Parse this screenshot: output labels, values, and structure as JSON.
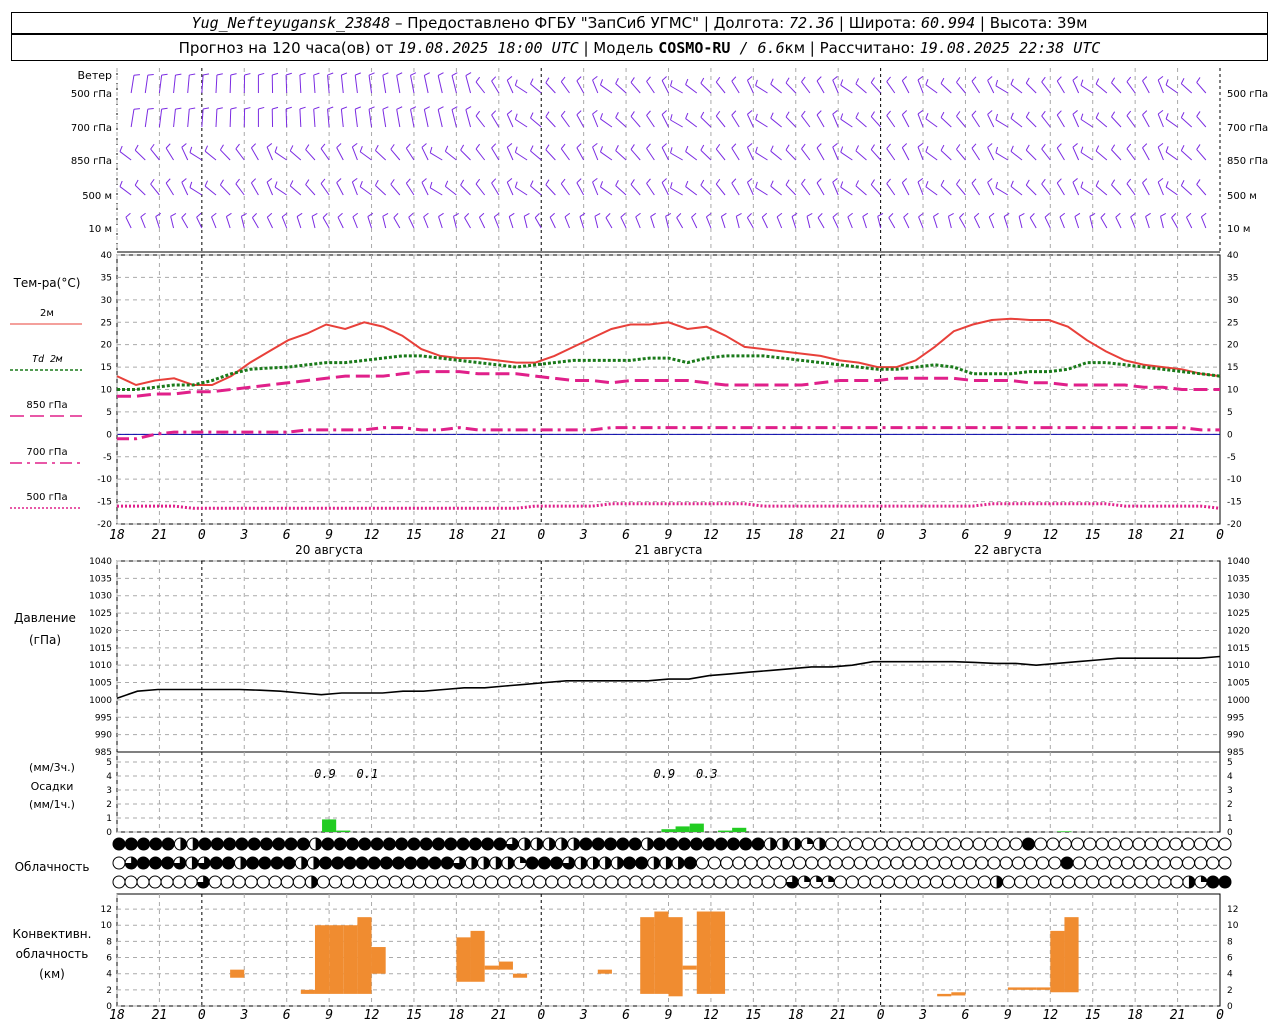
{
  "header": {
    "station": "Yug_Nefteyugansk_23848",
    "provider": " – Предоставлено ФГБУ \"ЗапСиб УГМС\" | ",
    "lon_label": "Долгота: ",
    "lon_value": "72.36",
    "lat_label": " | Широта: ",
    "lat_value": "60.994",
    "alt_label": " | Высота: 39м",
    "forecast_prefix": "Прогноз на 120 часа(ов)  от ",
    "forecast_time": "19.08.2025 18:00 UTC",
    "model_label": "  | Модель ",
    "model_name": "COSMO-RU",
    "model_res": " / 6.6",
    "model_res_unit": "км | Рассчитано: ",
    "computed_time": "19.08.2025 22:38 UTC"
  },
  "wind_panel": {
    "title": "Ветер",
    "levels": [
      "500 гПа",
      "700 гПа",
      "850 гПа",
      "500 м",
      "10 м"
    ],
    "color": "#7b2be2"
  },
  "x_axis": {
    "hour_labels": [
      "18",
      "21",
      "0",
      "3",
      "6",
      "9",
      "12",
      "15",
      "18",
      "21",
      "0",
      "3",
      "6",
      "9",
      "12",
      "15",
      "18",
      "21",
      "0",
      "3",
      "6",
      "9",
      "12",
      "15",
      "18",
      "21",
      "0"
    ],
    "day_labels": [
      "20 августа",
      "21 августа",
      "22 августа"
    ]
  },
  "chart_data": [
    {
      "type": "line",
      "panel": "temperature",
      "title": "Тем-ра(°C)",
      "x_hours": [
        0,
        3,
        6,
        9,
        12,
        15,
        18,
        21,
        24,
        27,
        30,
        33,
        36,
        39,
        42,
        45,
        48,
        51,
        54,
        57,
        60,
        63,
        66,
        69,
        72,
        75,
        78,
        81,
        84,
        87,
        90,
        93,
        96,
        99,
        102,
        105,
        108,
        111,
        114,
        117,
        120,
        123,
        126,
        129,
        132,
        135,
        138,
        141,
        144,
        147,
        150,
        153,
        156,
        159,
        162,
        165,
        168,
        171,
        174,
        177,
        180,
        183,
        186,
        189,
        192,
        195,
        198,
        201,
        204,
        207,
        210,
        213,
        216,
        219,
        222,
        225,
        228,
        231,
        234
      ],
      "ylim": [
        -20,
        40
      ],
      "yticks": [
        -20,
        -15,
        -10,
        -5,
        0,
        5,
        10,
        15,
        20,
        25,
        30,
        35,
        40
      ],
      "series": [
        {
          "name": "2м",
          "color": "#e8403a",
          "dash": "solid",
          "values": [
            13,
            11,
            12,
            12.5,
            11,
            11,
            13,
            16,
            18.5,
            21,
            22.5,
            24.5,
            23.5,
            25,
            24,
            22,
            19,
            17.5,
            17,
            17,
            16.5,
            16,
            16,
            17.5,
            19.5,
            21.5,
            23.5,
            24.5,
            24.5,
            25,
            23.5,
            24,
            22,
            19.5,
            19,
            18.5,
            18,
            17.5,
            16.5,
            16,
            15,
            15,
            16.5,
            19.5,
            23,
            24.5,
            25.5,
            25.8,
            25.5,
            25.5,
            24,
            21,
            18.5,
            16.5,
            15.5,
            15,
            14.5,
            13.5,
            13
          ]
        },
        {
          "name": "Td 2м",
          "color": "#1a7a1a",
          "dash": "dot",
          "values": [
            10,
            10,
            10.5,
            11,
            11,
            12,
            13.5,
            14.5,
            14.8,
            15,
            15.5,
            16,
            16,
            16.5,
            17,
            17.5,
            17.5,
            17,
            16.5,
            16,
            15.5,
            15,
            15.5,
            16,
            16.5,
            16.5,
            16.5,
            16.5,
            17,
            17,
            16,
            17,
            17.5,
            17.5,
            17.5,
            17,
            16.5,
            16,
            15.5,
            15,
            14.5,
            14.5,
            15,
            15.5,
            15,
            13.5,
            13.5,
            13.5,
            14,
            14,
            14.5,
            16,
            16,
            15.5,
            15,
            14.5,
            14,
            13.5,
            13
          ]
        },
        {
          "name": "850 гПа",
          "color": "#e0208a",
          "dash": "dash",
          "values": [
            8.5,
            8.5,
            9,
            9,
            9.5,
            9.5,
            10,
            10.5,
            11,
            11.5,
            12,
            12.5,
            13,
            13,
            13,
            13.5,
            14,
            14,
            14,
            13.5,
            13.5,
            13.5,
            13,
            12.5,
            12,
            12,
            11.5,
            12,
            12,
            12,
            12,
            11.5,
            11,
            11,
            11,
            11,
            11,
            11.5,
            12,
            12,
            12,
            12.5,
            12.5,
            12.5,
            12.5,
            12,
            12,
            12,
            11.5,
            11.5,
            11,
            11,
            11,
            11,
            10.5,
            10.5,
            10,
            10,
            10
          ]
        },
        {
          "name": "700 гПа",
          "color": "#e0208a",
          "dash": "dashdot",
          "values": [
            -1,
            -1,
            0,
            0.5,
            0.5,
            0.5,
            0.5,
            0.5,
            0.5,
            0.5,
            1,
            1,
            1,
            1,
            1.5,
            1.5,
            1,
            1,
            1.5,
            1,
            1,
            1,
            1,
            1,
            1,
            1,
            1.5,
            1.5,
            1.5,
            1.5,
            1.5,
            1.5,
            1.5,
            1.5,
            1.5,
            1.5,
            1.5,
            1.5,
            1.5,
            1.5,
            1.5,
            1.5,
            1.5,
            1.5,
            1.5,
            1.5,
            1.5,
            1.5,
            1.5,
            1.5,
            1.5,
            1.5,
            1.5,
            1.5,
            1.5,
            1.5,
            1.5,
            1,
            1
          ]
        },
        {
          "name": "500 гПа",
          "color": "#e0208a",
          "dash": "dotfine",
          "values": [
            -16,
            -16,
            -16,
            -16,
            -16.5,
            -16.5,
            -16.5,
            -16.5,
            -16.5,
            -16.5,
            -16.5,
            -16.5,
            -16.5,
            -16.5,
            -16.5,
            -16.5,
            -16.5,
            -16.5,
            -16.5,
            -16.5,
            -16.5,
            -16.5,
            -16,
            -16,
            -16,
            -16,
            -15.5,
            -15.5,
            -15.5,
            -15.5,
            -15.5,
            -15.5,
            -15.5,
            -15.5,
            -16,
            -16,
            -16,
            -16,
            -16,
            -16,
            -16,
            -16,
            -16,
            -16,
            -16,
            -16,
            -15.5,
            -15.5,
            -15.5,
            -15.5,
            -15.5,
            -15.5,
            -15.5,
            -16,
            -16,
            -16,
            -16,
            -16,
            -16.5
          ]
        }
      ]
    },
    {
      "type": "line",
      "panel": "pressure",
      "title": "Давление",
      "unit": "(гПа)",
      "ylim": [
        985,
        1040
      ],
      "yticks": [
        985,
        990,
        995,
        1000,
        1005,
        1010,
        1015,
        1020,
        1025,
        1030,
        1035,
        1040
      ],
      "series": [
        {
          "name": "Давление",
          "color": "#000000",
          "dash": "solid",
          "values": [
            1000.5,
            1002.5,
            1003,
            1003,
            1003,
            1003,
            1003,
            1002.8,
            1002.5,
            1002,
            1001.5,
            1002,
            1002,
            1002,
            1002.5,
            1002.5,
            1003,
            1003.5,
            1003.5,
            1004,
            1004.5,
            1005,
            1005.5,
            1005.5,
            1005.5,
            1005.5,
            1005.5,
            1006,
            1006,
            1007,
            1007.5,
            1008,
            1008.5,
            1009,
            1009.5,
            1009.5,
            1010,
            1011,
            1011,
            1011,
            1011,
            1011,
            1010.8,
            1010.5,
            1010.5,
            1010,
            1010.5,
            1011,
            1011.5,
            1012,
            1012,
            1012,
            1012,
            1012,
            1012.5
          ]
        }
      ]
    },
    {
      "type": "bar",
      "panel": "precipitation",
      "title": "Осадки",
      "unit_top": "(мм/3ч.)",
      "unit_bottom": "(мм/1ч.)",
      "ylim": [
        0,
        5
      ],
      "yticks": [
        0,
        1,
        2,
        3,
        4,
        5
      ],
      "color": "#22cc22",
      "bars": [
        {
          "hour": 15,
          "value": 0.9
        },
        {
          "hour": 16,
          "value": 0.1
        },
        {
          "hour": 39,
          "value": 0.2
        },
        {
          "hour": 40,
          "value": 0.4
        },
        {
          "hour": 41,
          "value": 0.6
        },
        {
          "hour": 43,
          "value": 0.1
        },
        {
          "hour": 44,
          "value": 0.3
        },
        {
          "hour": 67,
          "value": 0.05
        }
      ],
      "totals_3h": [
        {
          "hour": 14,
          "label": "0.9"
        },
        {
          "hour": 17,
          "label": "0.1"
        },
        {
          "hour": 38,
          "label": "0.9"
        },
        {
          "hour": 41,
          "label": "0.3"
        }
      ]
    },
    {
      "type": "bar",
      "panel": "convective",
      "title_lines": [
        "Конвективн.",
        "облачность",
        "(км)"
      ],
      "ylim": [
        0,
        13
      ],
      "yticks": [
        0,
        2,
        4,
        6,
        8,
        10,
        12
      ],
      "color": "#f08c30",
      "bars": [
        {
          "hour": 8.5,
          "bottom": 3.5,
          "top": 4.5
        },
        {
          "hour": 13.5,
          "bottom": 1.5,
          "top": 2
        },
        {
          "hour": 14.5,
          "bottom": 1.5,
          "top": 10
        },
        {
          "hour": 15.5,
          "bottom": 1.5,
          "top": 10
        },
        {
          "hour": 16.5,
          "bottom": 1.5,
          "top": 10
        },
        {
          "hour": 17.5,
          "bottom": 1.5,
          "top": 11
        },
        {
          "hour": 18.5,
          "bottom": 4,
          "top": 7.3
        },
        {
          "hour": 24.5,
          "bottom": 3,
          "top": 8.5
        },
        {
          "hour": 25.5,
          "bottom": 3,
          "top": 9.3
        },
        {
          "hour": 26.5,
          "bottom": 4.5,
          "top": 5
        },
        {
          "hour": 27.5,
          "bottom": 4.5,
          "top": 5.5
        },
        {
          "hour": 28.5,
          "bottom": 3.5,
          "top": 4
        },
        {
          "hour": 34.5,
          "bottom": 4,
          "top": 4.5
        },
        {
          "hour": 37.5,
          "bottom": 1.5,
          "top": 11
        },
        {
          "hour": 38.5,
          "bottom": 1.5,
          "top": 11.7
        },
        {
          "hour": 39.5,
          "bottom": 1.2,
          "top": 11
        },
        {
          "hour": 40.5,
          "bottom": 4.5,
          "top": 5
        },
        {
          "hour": 41.5,
          "bottom": 1.5,
          "top": 11.7
        },
        {
          "hour": 42.5,
          "bottom": 1.5,
          "top": 11.7
        },
        {
          "hour": 58.5,
          "bottom": 1.2,
          "top": 1.5
        },
        {
          "hour": 59.5,
          "bottom": 1.3,
          "top": 1.7
        },
        {
          "hour": 63.5,
          "bottom": 2,
          "top": 2.3
        },
        {
          "hour": 64.5,
          "bottom": 2,
          "top": 2.3
        },
        {
          "hour": 65.5,
          "bottom": 2,
          "top": 2.3
        },
        {
          "hour": 66.5,
          "bottom": 1.7,
          "top": 9.3
        },
        {
          "hour": 67.5,
          "bottom": 1.7,
          "top": 11
        }
      ]
    }
  ],
  "cloud_panel": {
    "title": "Облачность",
    "rows_description": "upper/middle/low cloud cover glyphs (fraction of 1 filled)",
    "rows": [
      [
        1,
        1,
        1,
        1,
        1,
        0.5,
        0.5,
        1,
        1,
        1,
        1,
        1,
        1,
        1,
        1,
        1,
        0.5,
        1,
        1,
        1,
        1,
        1,
        1,
        1,
        1,
        1,
        1,
        1,
        1,
        1,
        1,
        1,
        0.75,
        0.5,
        0.5,
        0.5,
        0.5,
        0.5,
        1,
        1,
        1,
        1,
        1,
        0.5,
        1,
        1,
        1,
        1,
        1,
        1,
        1,
        1,
        1,
        0.5,
        0.5,
        0.5,
        0.25,
        0.5,
        0,
        0,
        0,
        0,
        0,
        0,
        0,
        0,
        0,
        0,
        0,
        0,
        0,
        0,
        0,
        0,
        1,
        0,
        0,
        0,
        0,
        0,
        0,
        0,
        0,
        0,
        0,
        0,
        0,
        0,
        0,
        0,
        0
      ],
      [
        0,
        0.75,
        1,
        1,
        1,
        0.75,
        0.5,
        0.75,
        1,
        1,
        0.5,
        1,
        1,
        1,
        1,
        0.5,
        0.5,
        1,
        1,
        1,
        1,
        1,
        1,
        1,
        1,
        1,
        1,
        1,
        0.75,
        0.5,
        0.5,
        0.5,
        0.5,
        0.25,
        1,
        1,
        1,
        0.75,
        0.5,
        0.5,
        0.5,
        0.5,
        1,
        1,
        0.5,
        0.5,
        0.5,
        1,
        0,
        0,
        0,
        0,
        0,
        0,
        0,
        0,
        0,
        0,
        0,
        0,
        0,
        0,
        0,
        0,
        0,
        0,
        0,
        0,
        0,
        0,
        0,
        0,
        0,
        0,
        0,
        0,
        0,
        0,
        1,
        0,
        0,
        0,
        0,
        0,
        0,
        0,
        0,
        0,
        0,
        0,
        0,
        0
      ],
      [
        0,
        0,
        0,
        0,
        0,
        0,
        0,
        0.75,
        0,
        0,
        0,
        0,
        0,
        0,
        0,
        0,
        0.5,
        0,
        0,
        0,
        0,
        0,
        0,
        0,
        0,
        0,
        0,
        0,
        0,
        0,
        0,
        0,
        0,
        0,
        0,
        0,
        0,
        0,
        0,
        0,
        0,
        0,
        0,
        0,
        0,
        0,
        0,
        0,
        0,
        0,
        0,
        0,
        0,
        0,
        0,
        0,
        0.75,
        0.25,
        0.25,
        0.25,
        0,
        0,
        0,
        0,
        0,
        0,
        0,
        0,
        0,
        0,
        0,
        0,
        0,
        0.5,
        0,
        0,
        0,
        0,
        0,
        0,
        0,
        0,
        0,
        0,
        0,
        0,
        0,
        0,
        0,
        0.5,
        0.25,
        1,
        1
      ]
    ]
  }
}
